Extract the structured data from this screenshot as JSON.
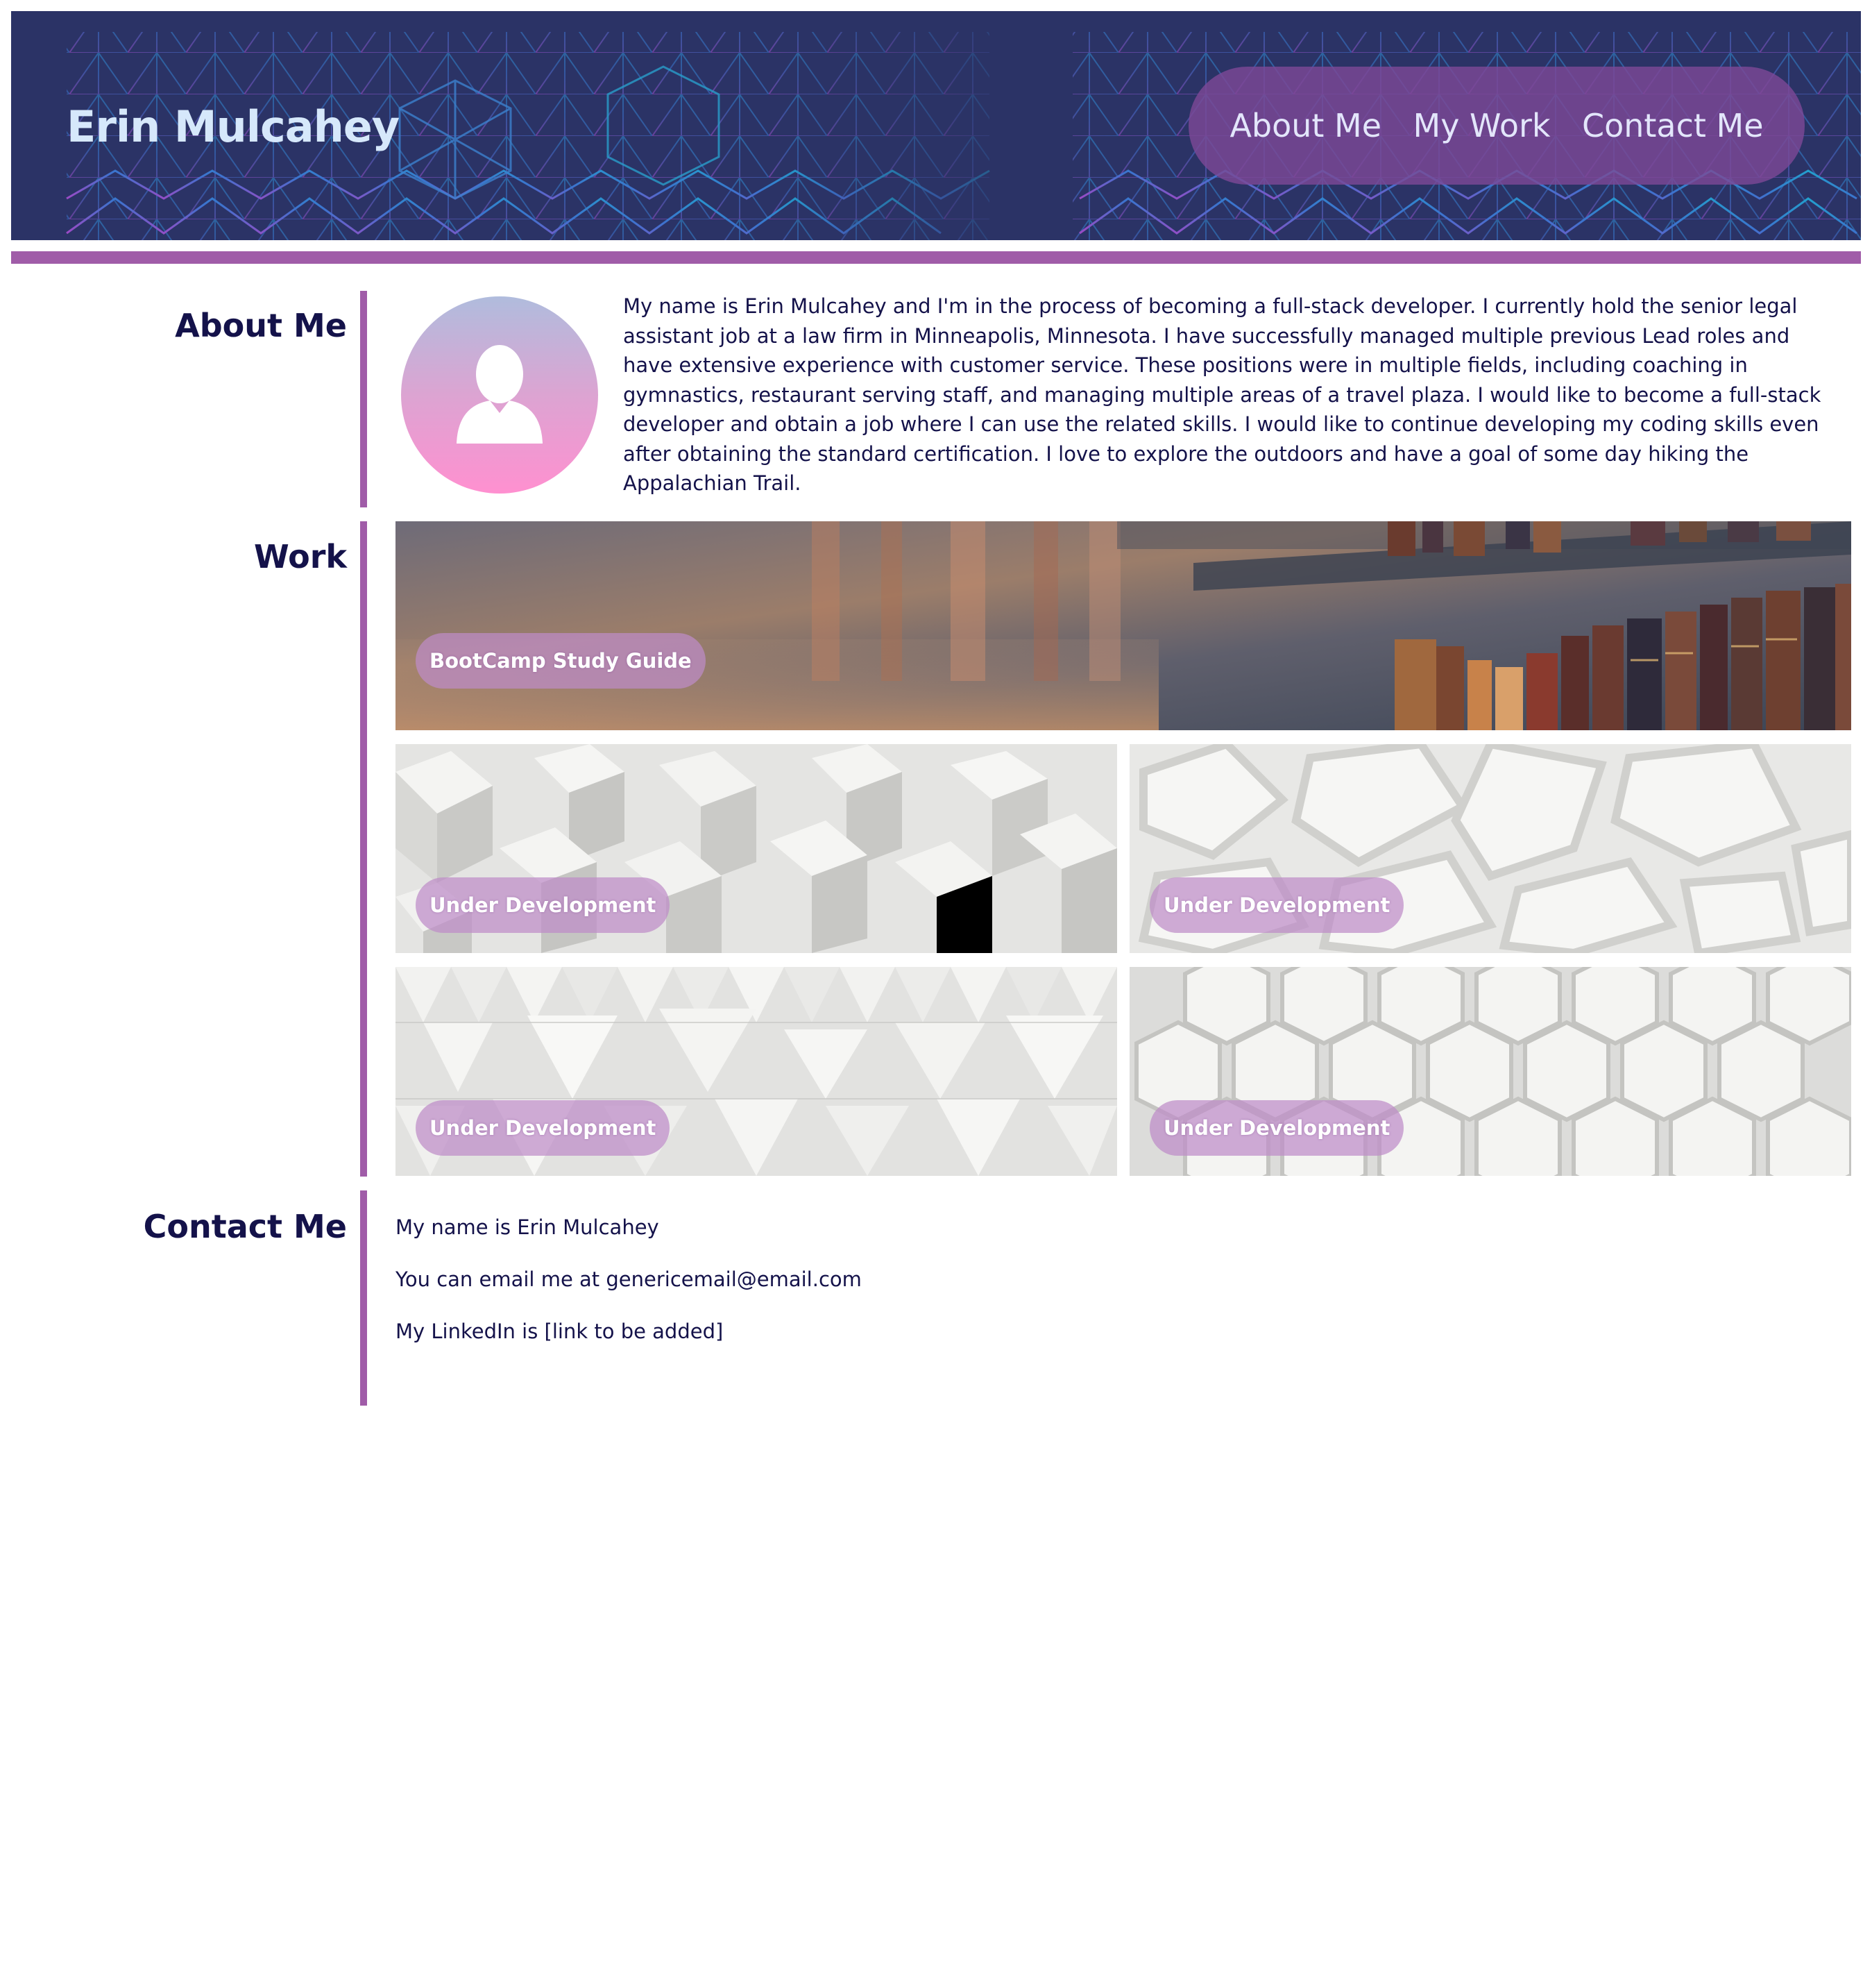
{
  "header": {
    "title": "Erin Mulcahey",
    "nav": [
      {
        "label": "About Me"
      },
      {
        "label": "My Work"
      },
      {
        "label": "Contact Me"
      }
    ]
  },
  "about": {
    "heading": "About Me",
    "bio": "My name is Erin Mulcahey and I'm in the process of becoming a full-stack developer. I currently hold the senior legal assistant job at a law firm in Minneapolis, Minnesota. I have successfully managed multiple previous Lead roles and have extensive experience with customer service. These positions were in multiple fields, including coaching in gymnastics, restaurant serving staff, and managing multiple areas of a travel plaza. I would like to become a full-stack developer and obtain a job where I can use the related skills. I would like to continue developing my coding skills even after obtaining the standard certification. I love to explore the outdoors and have a goal of some day hiking the Appalachian Trail."
  },
  "work": {
    "heading": "Work",
    "projects": [
      {
        "label": "BootCamp Study Guide"
      },
      {
        "label": "Under Development"
      },
      {
        "label": "Under Development"
      },
      {
        "label": "Under Development"
      },
      {
        "label": "Under Development"
      }
    ]
  },
  "contact": {
    "heading": "Contact Me",
    "lines": [
      "My name is Erin Mulcahey",
      "You can email me at genericemail@email.com",
      "My LinkedIn is [link to be added]"
    ]
  },
  "colors": {
    "header_bg": "#2b3366",
    "accent": "#a05ca8",
    "nav_pill": "#7d4896",
    "title_text": "#d6e8fb",
    "body_text": "#14124a"
  }
}
